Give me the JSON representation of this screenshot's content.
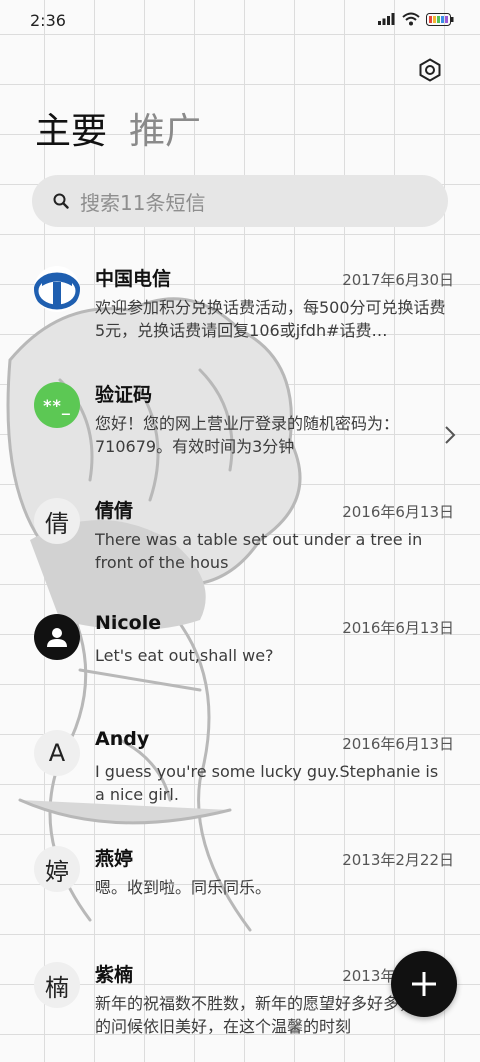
{
  "status_bar": {
    "time": "2:36"
  },
  "tabs": [
    {
      "label": "主要",
      "active": true
    },
    {
      "label": "推广",
      "active": false
    }
  ],
  "search": {
    "placeholder": "搜索11条短信"
  },
  "conversations": [
    {
      "name": "中国电信",
      "date": "2017年6月30日",
      "preview": "欢迎参加积分兑换话费活动，每500分可兑换话费5元，兑换话费请回复106或jfdh#话费…",
      "avatar_type": "telecom-logo"
    },
    {
      "name": "验证码",
      "date": "",
      "preview": "您好！您的网上营业厅登录的随机密码为：710679。有效时间为3分钟",
      "avatar_text": "**_",
      "avatar_type": "code"
    },
    {
      "name": "倩倩",
      "date": "2016年6月13日",
      "preview": "There was a table set out under a tree in front of the hous",
      "avatar_text": "倩",
      "avatar_type": "letter"
    },
    {
      "name": "Nicole",
      "date": "2016年6月13日",
      "preview": "Let's eat out,shall we?",
      "avatar_type": "person-icon"
    },
    {
      "name": "Andy",
      "date": "2016年6月13日",
      "preview": "I guess you're some lucky guy.Stephanie is a nice girl.",
      "avatar_text": "A",
      "avatar_type": "letter"
    },
    {
      "name": "燕婷",
      "date": "2013年2月22日",
      "preview": "嗯。收到啦。同乐同乐。",
      "avatar_text": "婷",
      "avatar_type": "letter"
    },
    {
      "name": "紫楠",
      "date": "2013年2月22日",
      "preview": "新年的祝福数不胜数，新年的愿望好多好多，新年的问候依旧美好，在这个温馨的时刻",
      "avatar_text": "楠",
      "avatar_type": "letter"
    }
  ],
  "colors": {
    "accent_green": "#5cc854",
    "fab": "#111111",
    "telecom_blue": "#1f5fb0"
  }
}
